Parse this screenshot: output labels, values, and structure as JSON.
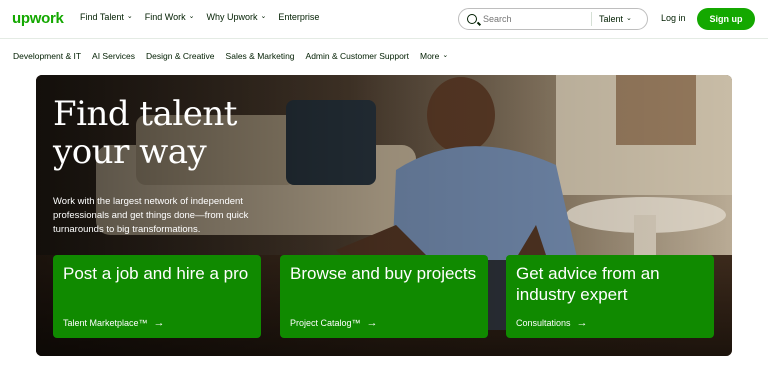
{
  "brand": {
    "logo": "upwork",
    "color": "#14a800"
  },
  "nav": {
    "links": [
      {
        "label": "Find Talent",
        "dropdown": true
      },
      {
        "label": "Find Work",
        "dropdown": true
      },
      {
        "label": "Why Upwork",
        "dropdown": true
      },
      {
        "label": "Enterprise",
        "dropdown": false
      }
    ],
    "search": {
      "placeholder": "Search",
      "scope": "Talent"
    },
    "login": "Log in",
    "signup": "Sign up"
  },
  "categories": {
    "items": [
      "Development & IT",
      "AI Services",
      "Design & Creative",
      "Sales & Marketing",
      "Admin & Customer Support"
    ],
    "more": "More"
  },
  "hero": {
    "title_line1": "Find talent",
    "title_line2": "your way",
    "subtitle": "Work with the largest network of independent professionals and get things done—from quick turnarounds to big transformations.",
    "cards": [
      {
        "title": "Post a job and hire a pro",
        "link": "Talent Marketplace™"
      },
      {
        "title": "Browse and buy projects",
        "link": "Project Catalog™"
      },
      {
        "title": "Get advice from an industry expert",
        "link": "Consultations"
      }
    ],
    "card_color": "#108a00"
  }
}
